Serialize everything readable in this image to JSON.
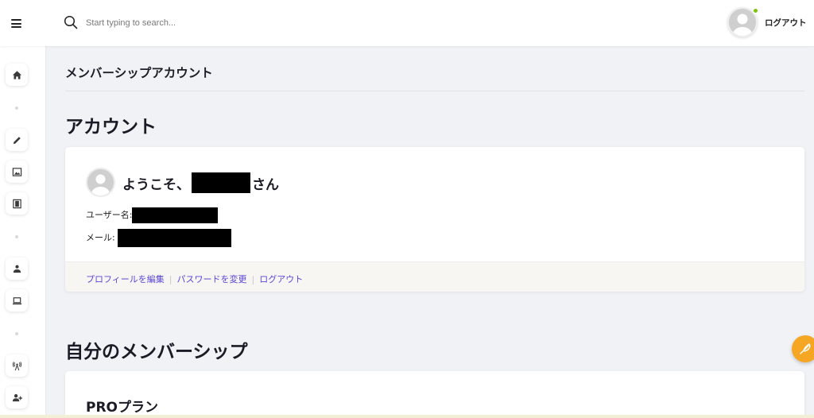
{
  "header": {
    "search_placeholder": "Start typing to search...",
    "logout_label": "ログアウト"
  },
  "sidebar": {
    "items": [
      {
        "icon": "home-icon"
      },
      {
        "icon": "pencil-icon"
      },
      {
        "icon": "image-icon"
      },
      {
        "icon": "film-icon"
      },
      {
        "icon": "users-icon"
      },
      {
        "icon": "laptop-icon"
      },
      {
        "icon": "broadcast-icon"
      },
      {
        "icon": "add-user-icon"
      }
    ]
  },
  "page": {
    "breadcrumb_title": "メンバーシップアカウント",
    "account_heading": "アカウント",
    "membership_heading": "自分のメンバーシップ"
  },
  "account": {
    "welcome_prefix": "ようこそ、",
    "welcome_suffix": "さん",
    "username_label": "ユーザー名:",
    "email_label": "メール:",
    "links": {
      "edit_profile": "プロフィールを編集",
      "change_password": "パスワードを変更",
      "logout": "ログアウト"
    }
  },
  "membership": {
    "plan_name": "PROプラン"
  },
  "colors": {
    "accent_link": "#5b47d6",
    "fab": "#f5a623",
    "online": "#7cc20e"
  }
}
